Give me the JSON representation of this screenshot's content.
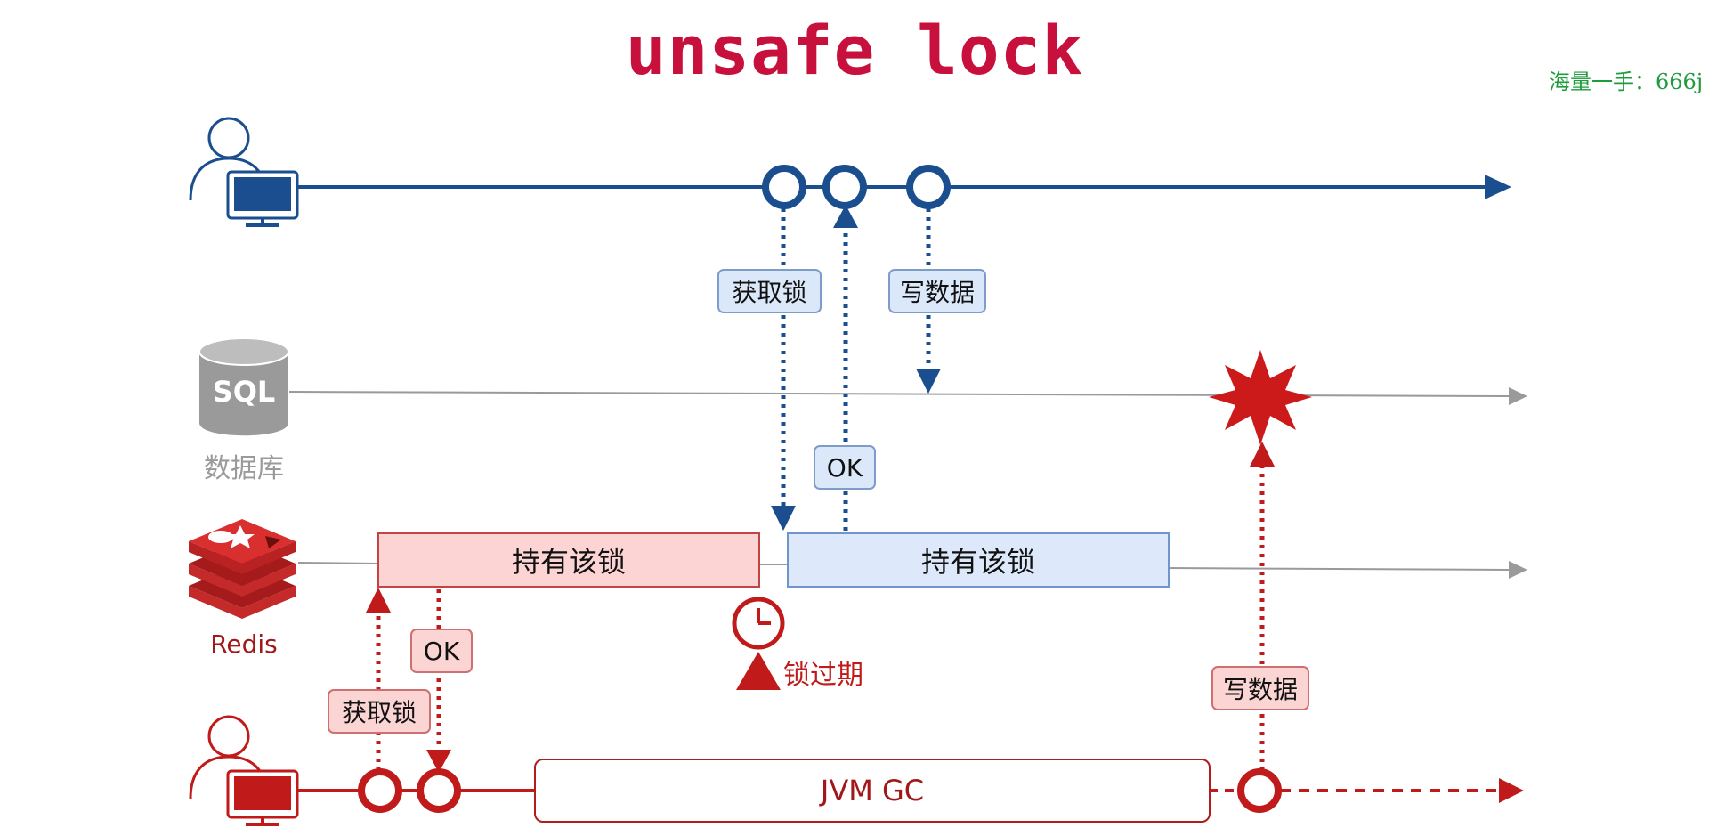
{
  "title": "unsafe lock",
  "watermark": "海量一手：666j",
  "actors": {
    "database_label": "数据库",
    "database_icon_text": "SQL",
    "redis_label": "Redis"
  },
  "tags": {
    "blue_acquire": "获取锁",
    "blue_write": "写数据",
    "blue_ok": "OK",
    "red_ok": "OK",
    "red_acquire": "获取锁",
    "red_write": "写数据"
  },
  "boxes": {
    "red_hold": "持有该锁",
    "blue_hold": "持有该锁",
    "jvm_gc": "JVM GC"
  },
  "lock_expired": "锁过期",
  "colors": {
    "title": "#c8103c",
    "blue": "#1a4e8f",
    "red": "#c01a1a",
    "gray": "#9a9a9a",
    "watermark": "#1e9b3a"
  }
}
